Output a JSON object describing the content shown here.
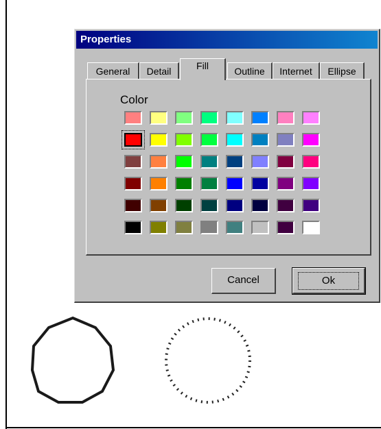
{
  "dialog": {
    "title": "Properties",
    "tabs": [
      {
        "label": "General"
      },
      {
        "label": "Detail"
      },
      {
        "label": "Fill",
        "active": true
      },
      {
        "label": "Outline"
      },
      {
        "label": "Internet"
      },
      {
        "label": "Ellipse"
      }
    ],
    "fill": {
      "color_label": "Color",
      "selected_color": "#ff0000",
      "palette": [
        [
          "#ff8080",
          "#ffff80",
          "#80ff80",
          "#00ff80",
          "#80ffff",
          "#0080ff",
          "#ff80c0",
          "#ff80ff"
        ],
        [
          "#ff0000",
          "#ffff00",
          "#80ff00",
          "#00ff40",
          "#00ffff",
          "#0080c0",
          "#8080c0",
          "#ff00ff"
        ],
        [
          "#804040",
          "#ff8040",
          "#00ff00",
          "#008080",
          "#004080",
          "#8080ff",
          "#800040",
          "#ff0080"
        ],
        [
          "#800000",
          "#ff8000",
          "#008000",
          "#008040",
          "#0000ff",
          "#0000a0",
          "#800080",
          "#8000ff"
        ],
        [
          "#400000",
          "#804000",
          "#004000",
          "#004040",
          "#000080",
          "#000040",
          "#400040",
          "#400080"
        ],
        [
          "#000000",
          "#808000",
          "#808040",
          "#808080",
          "#408080",
          "#c0c0c0",
          "#400040",
          "#ffffff"
        ]
      ]
    },
    "buttons": {
      "cancel": "Cancel",
      "ok": "Ok"
    }
  }
}
